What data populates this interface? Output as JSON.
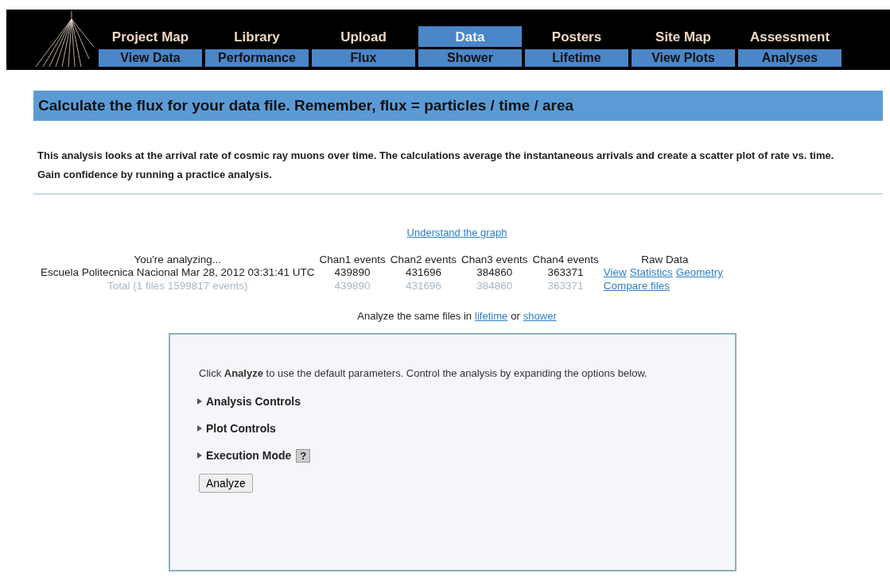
{
  "nav": {
    "tabs": [
      {
        "label": "Project Map",
        "selected": false
      },
      {
        "label": "Library",
        "selected": false
      },
      {
        "label": "Upload",
        "selected": false
      },
      {
        "label": "Data",
        "selected": true
      },
      {
        "label": "Posters",
        "selected": false
      },
      {
        "label": "Site Map",
        "selected": false
      },
      {
        "label": "Assessment",
        "selected": false
      }
    ],
    "subtabs": [
      "View Data",
      "Performance",
      "Flux",
      "Shower",
      "Lifetime",
      "View Plots",
      "Analyses"
    ]
  },
  "heading": "Calculate the flux for your data file. Remember, flux = particles / time / area",
  "intro": [
    "This analysis looks at the arrival rate of cosmic ray muons over time. The calculations average the instantaneous arrivals and create a scatter plot of rate vs. time.",
    "Gain confidence by running a practice analysis."
  ],
  "graph_link": "Understand the graph",
  "files_table": {
    "columns": [
      "You're analyzing...",
      "Chan1 events",
      "Chan2 events",
      "Chan3 events",
      "Chan4 events",
      "Raw Data"
    ],
    "rows": [
      {
        "kind": "file",
        "name": "Escuela Politecnica Nacional Mar 28, 2012 03:31:41 UTC",
        "counts": [
          "439890",
          "431696",
          "384860",
          "363371"
        ],
        "links": [
          "View",
          "Statistics",
          "Geometry"
        ]
      },
      {
        "kind": "total",
        "name": "Total (1 files 1599817 events)",
        "counts": [
          "439890",
          "431696",
          "384860",
          "363371"
        ],
        "links": [
          "Compare files"
        ]
      }
    ]
  },
  "same_files": {
    "text": "Analyze the same files in",
    "first_link": "lifetime",
    "joiner": "or",
    "second_link": "shower"
  },
  "panel": {
    "instructions": "Click **Analyze** to use the default parameters. Control the analysis by expanding the options below.",
    "sections": [
      {
        "label": "Analysis Controls",
        "expanded": false
      },
      {
        "label": "Plot Controls",
        "expanded": false
      },
      {
        "label": "Execution Mode",
        "expanded": false,
        "help": "?"
      }
    ],
    "button": "Analyze"
  }
}
